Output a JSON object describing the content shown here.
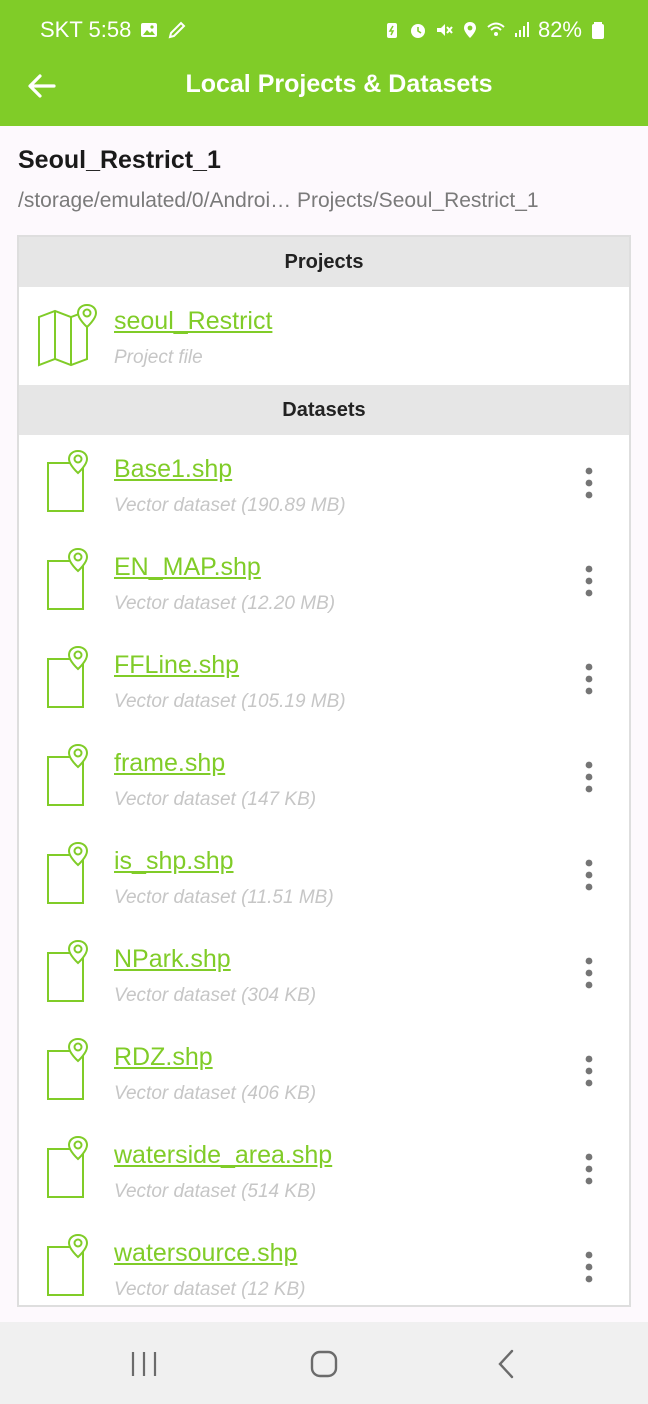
{
  "status_bar": {
    "carrier_time": "SKT 5:58",
    "battery": "82%",
    "icons_left": [
      "image-icon",
      "pencil-icon"
    ],
    "icons_right": [
      "battery-saver-icon",
      "alarm-icon",
      "mute-icon",
      "location-icon",
      "wifi-icon",
      "signal-icon",
      "battery-icon"
    ]
  },
  "toolbar": {
    "title": "Local Projects & Datasets",
    "back_icon": "arrow-left-icon"
  },
  "header": {
    "project_name": "Seoul_Restrict_1",
    "path": "/storage/emulated/0/Androi… Projects/Seoul_Restrict_1"
  },
  "sections": {
    "projects_label": "Projects",
    "datasets_label": "Datasets"
  },
  "projects": [
    {
      "name": "seoul_Restrict",
      "sub": "Project file",
      "icon": "map-pin-icon"
    }
  ],
  "datasets": [
    {
      "name": "Base1.shp",
      "sub": "Vector dataset (190.89 MB)"
    },
    {
      "name": "EN_MAP.shp",
      "sub": "Vector dataset (12.20 MB)"
    },
    {
      "name": "FFLine.shp",
      "sub": "Vector dataset (105.19 MB)"
    },
    {
      "name": "frame.shp",
      "sub": "Vector dataset (147 KB)"
    },
    {
      "name": "is_shp.shp",
      "sub": "Vector dataset (11.51 MB)"
    },
    {
      "name": "NPark.shp",
      "sub": "Vector dataset (304 KB)"
    },
    {
      "name": "RDZ.shp",
      "sub": "Vector dataset (406 KB)"
    },
    {
      "name": "waterside_area.shp",
      "sub": "Vector dataset (514 KB)"
    },
    {
      "name": "watersource.shp",
      "sub": "Vector dataset (12 KB)"
    }
  ],
  "navigation": {
    "buttons": [
      "recent-apps-icon",
      "home-icon",
      "back-icon"
    ]
  },
  "colors": {
    "accent": "#80cc28",
    "section_bg": "#e6e6e6",
    "subtitle": "#c6c6c6"
  }
}
